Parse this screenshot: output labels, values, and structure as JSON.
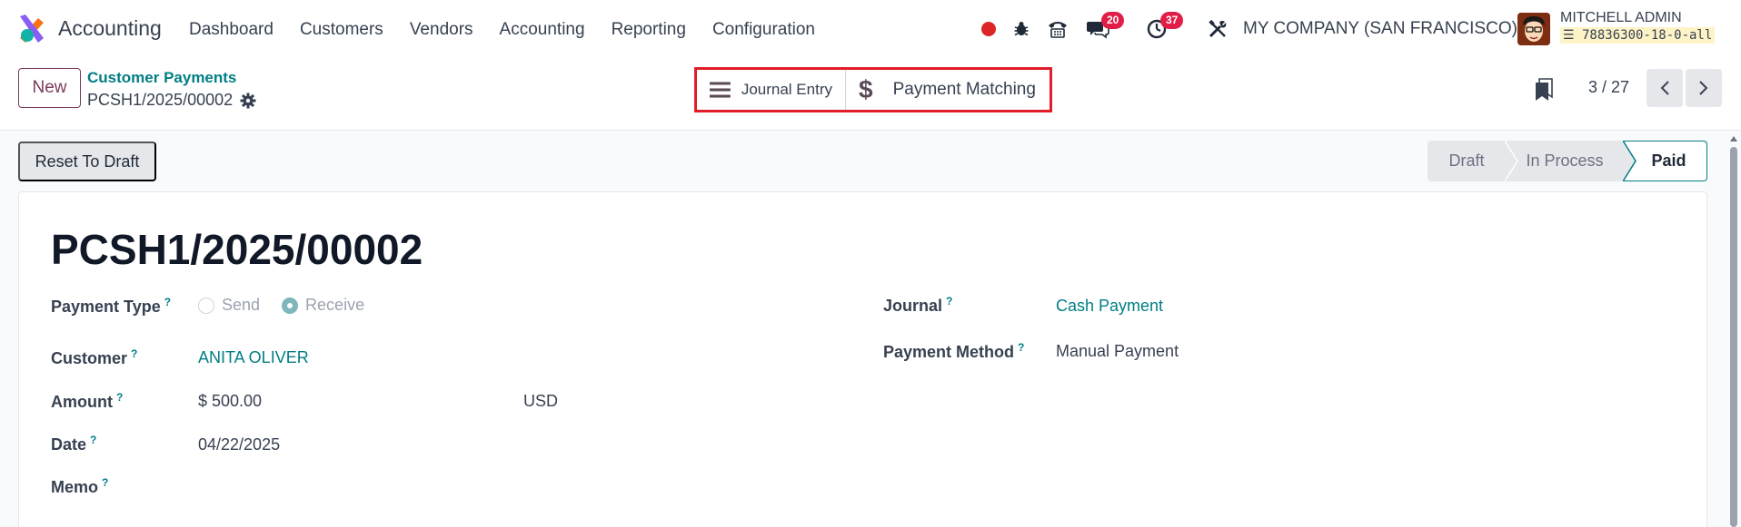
{
  "navbar": {
    "app_name": "Accounting",
    "menu": [
      "Dashboard",
      "Customers",
      "Vendors",
      "Accounting",
      "Reporting",
      "Configuration"
    ],
    "messages_count": "20",
    "activities_count": "37",
    "company": "MY COMPANY (SAN FRANCISCO)",
    "user_name": "MITCHELL ADMIN",
    "database": "78836300-18-0-all",
    "record_dot_color": "#dc2626",
    "badge_color": "#e11d48"
  },
  "control": {
    "new_label": "New",
    "breadcrumb_parent": "Customer Payments",
    "breadcrumb_current": "PCSH1/2025/00002",
    "smart_buttons": {
      "journal_entry": "Journal Entry",
      "payment_matching": "Payment Matching"
    },
    "pager": "3 / 27"
  },
  "statusbar": {
    "reset_label": "Reset To Draft",
    "stages": [
      "Draft",
      "In Process",
      "Paid"
    ],
    "current_stage": "Paid"
  },
  "form": {
    "title": "PCSH1/2025/00002",
    "payment_type": {
      "label": "Payment Type",
      "help": "?",
      "options": [
        "Send",
        "Receive"
      ],
      "selected": "Receive"
    },
    "customer": {
      "label": "Customer",
      "help": "?",
      "value": "ANITA OLIVER"
    },
    "amount": {
      "label": "Amount",
      "help": "?",
      "value": "$ 500.00",
      "currency": "USD"
    },
    "date": {
      "label": "Date",
      "help": "?",
      "value": "04/22/2025"
    },
    "memo": {
      "label": "Memo",
      "help": "?"
    },
    "journal": {
      "label": "Journal",
      "help": "?",
      "value": "Cash Payment"
    },
    "payment_method": {
      "label": "Payment Method",
      "help": "?",
      "value": "Manual Payment"
    }
  },
  "colors": {
    "accent_teal": "#017e84",
    "brand_purple": "#7c3a5c",
    "highlight_red": "#e11d2a"
  }
}
